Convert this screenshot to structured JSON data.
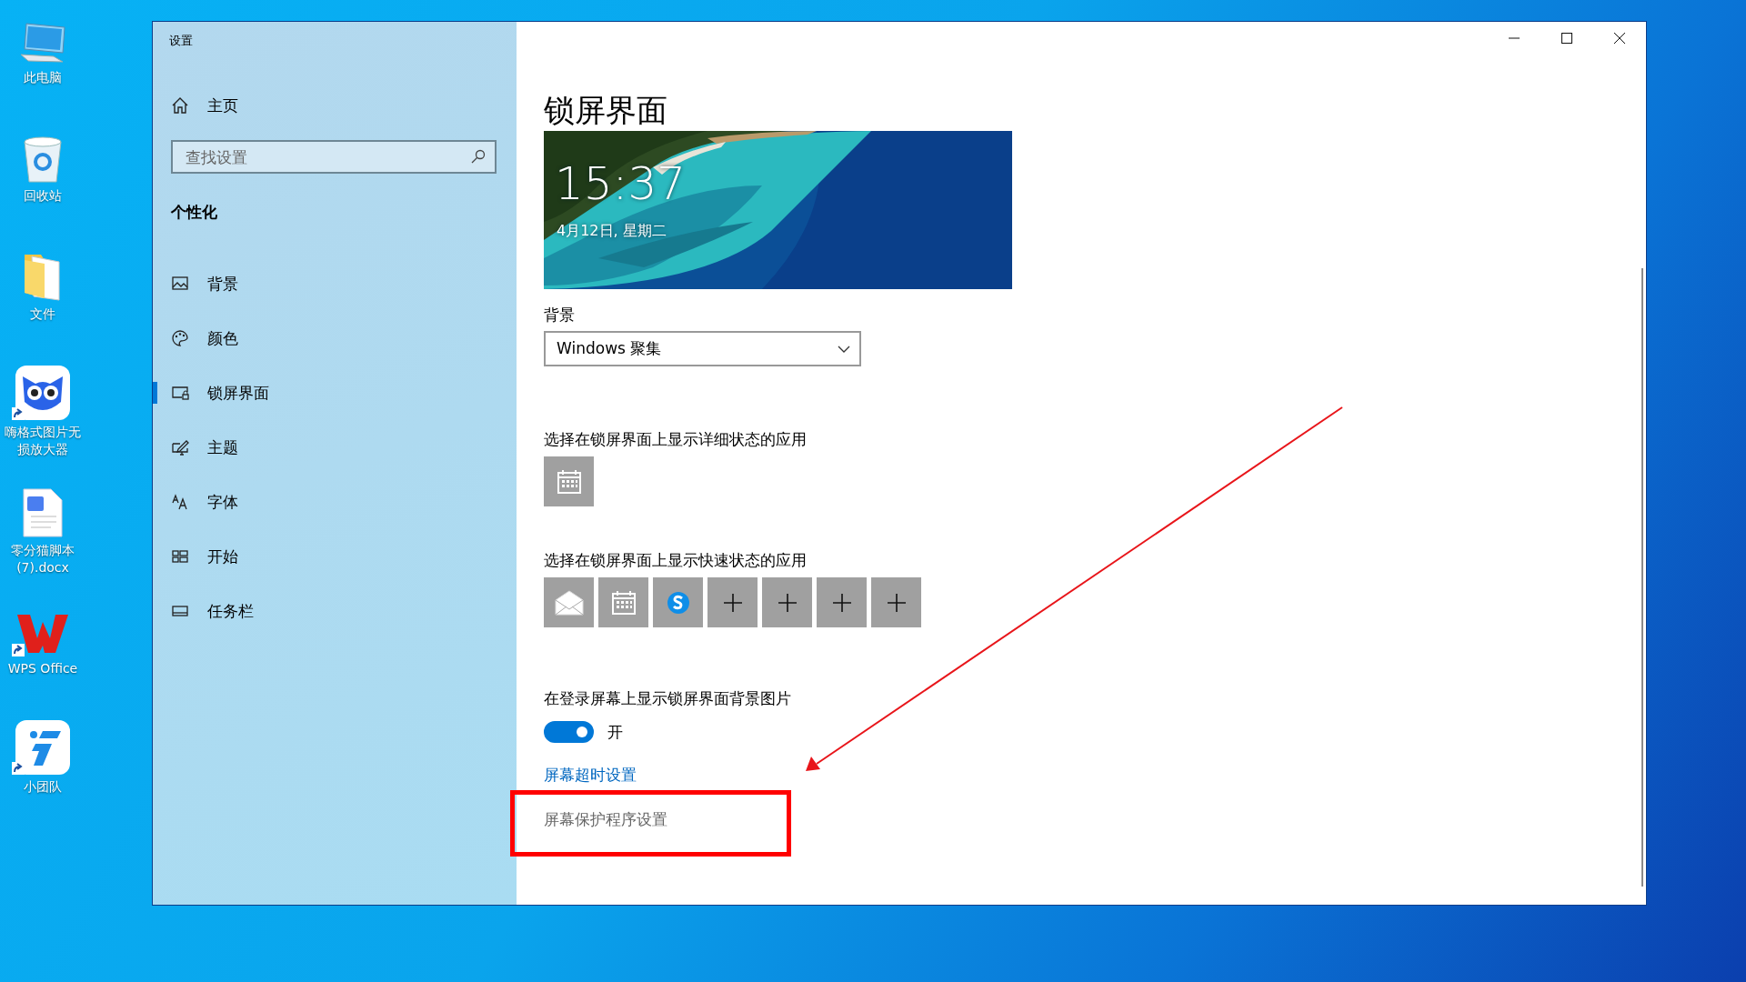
{
  "desktop_icons": [
    {
      "label": "此电脑",
      "shortcut": false
    },
    {
      "label": "回收站",
      "shortcut": false
    },
    {
      "label": "文件",
      "shortcut": false
    },
    {
      "label": "嗨格式图片无损放大器",
      "shortcut": true
    },
    {
      "label": "零分猫脚本(7).docx",
      "shortcut": false
    },
    {
      "label": "WPS Office",
      "shortcut": true
    },
    {
      "label": "小团队",
      "shortcut": true
    }
  ],
  "window": {
    "title": "设置"
  },
  "sidebar": {
    "home": "主页",
    "search": {
      "placeholder": "查找设置"
    },
    "section": "个性化",
    "items": [
      {
        "label": "背景",
        "selected": false
      },
      {
        "label": "颜色",
        "selected": false
      },
      {
        "label": "锁屏界面",
        "selected": true
      },
      {
        "label": "主题",
        "selected": false
      },
      {
        "label": "字体",
        "selected": false
      },
      {
        "label": "开始",
        "selected": false
      },
      {
        "label": "任务栏",
        "selected": false
      }
    ]
  },
  "page": {
    "heading": "锁屏界面",
    "preview": {
      "kind": "picture",
      "time": "15:37",
      "date": "4月12日, 星期二"
    },
    "background": {
      "label": "背景",
      "value": "Windows 聚集"
    },
    "detailed_status": {
      "label": "选择在锁屏界面上显示详细状态的应用",
      "apps": [
        {
          "kind": "app"
        }
      ]
    },
    "quick_status": {
      "label": "选择在锁屏界面上显示快速状态的应用",
      "apps": [
        {
          "kind": "app"
        },
        {
          "kind": "app"
        },
        {
          "kind": "app"
        },
        {
          "kind": "add"
        },
        {
          "kind": "add"
        },
        {
          "kind": "add"
        },
        {
          "kind": "add"
        }
      ]
    },
    "signin_background": {
      "label": "在登录屏幕上显示锁屏界面背景图片",
      "on": true,
      "state_text": "开"
    },
    "links": [
      "屏幕超时设置",
      "屏幕保护程序设置"
    ]
  }
}
